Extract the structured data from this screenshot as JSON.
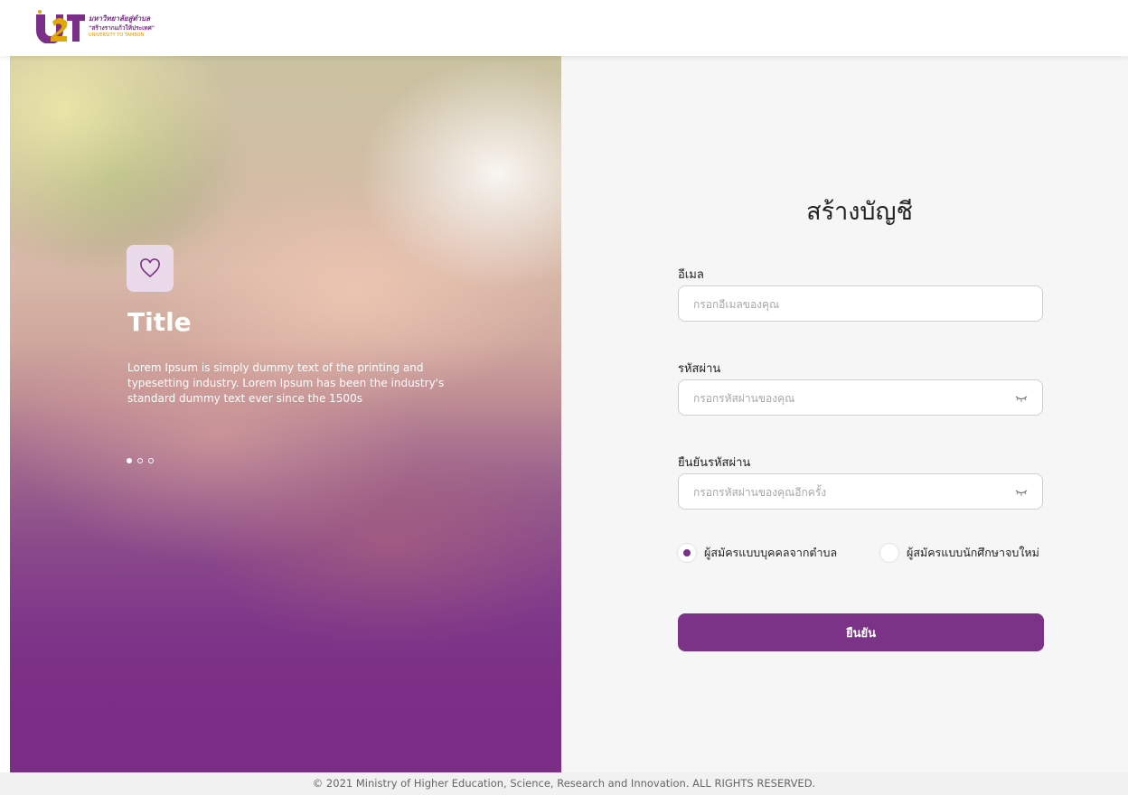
{
  "header": {
    "logo_mark": "U2T",
    "logo_line1": "มหาวิทยาลัยสู่ตำบล",
    "logo_line2": "\"สร้างรากแก้วให้ประเทศ\"",
    "logo_line3": "UNIVERSITY TO TAMBON"
  },
  "hero": {
    "title": "Title",
    "text": "Lorem Ipsum is simply dummy text of the printing and typesetting industry. Lorem Ipsum has been the industry's standard dummy text ever since the 1500s",
    "icon": "heart-icon",
    "slides_total": 3,
    "slide_active": 1
  },
  "form": {
    "title": "สร้างบัญชี",
    "email": {
      "label": "อีเมล",
      "placeholder": "กรอกอีเมลของคุณ",
      "value": ""
    },
    "password": {
      "label": "รหัสผ่าน",
      "placeholder": "กรอกรหัสผ่านของคุณ",
      "value": "",
      "toggle_icon": "eye-closed-icon"
    },
    "confirm_password": {
      "label": "ยืนยันรหัสผ่าน",
      "placeholder": "กรอกรหัสผ่านของคุณอีกครั้ง",
      "value": "",
      "toggle_icon": "eye-closed-icon"
    },
    "applicant_type": {
      "options": [
        "ผู้สมัครแบบบุคคลจากตำบล",
        "ผู้สมัครแบบนักศึกษาจบใหม่"
      ],
      "selected": "ผู้สมัครแบบบุคคลจากตำบล"
    },
    "submit_label": "ยืนยัน"
  },
  "footer": {
    "copyright": "© 2021 Ministry of Higher Education, Science, Research and Innovation. ALL RIGHTS RESERVED."
  },
  "colors": {
    "accent": "#7b3388",
    "panel_bg": "#f6f6f6",
    "footer_bg": "#f1f1f1"
  }
}
